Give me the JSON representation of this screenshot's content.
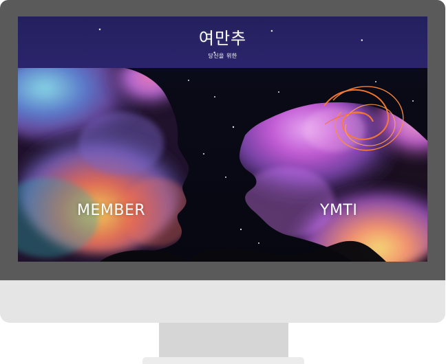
{
  "page": {
    "title": "여만추",
    "subtitle": "당신을 위한"
  },
  "navigation": {
    "member_label": "MEMBER",
    "ymti_label": "YMTI"
  },
  "colors": {
    "monitor_frame": "#5a5a5a",
    "monitor_chin": "#e5e5e5",
    "stand": "#d6d6d6",
    "banner_bg": "#26215f",
    "screen_bg": "#140d32"
  },
  "icons": {
    "left_face": "left-profile-illustration",
    "right_face": "right-profile-illustration"
  }
}
